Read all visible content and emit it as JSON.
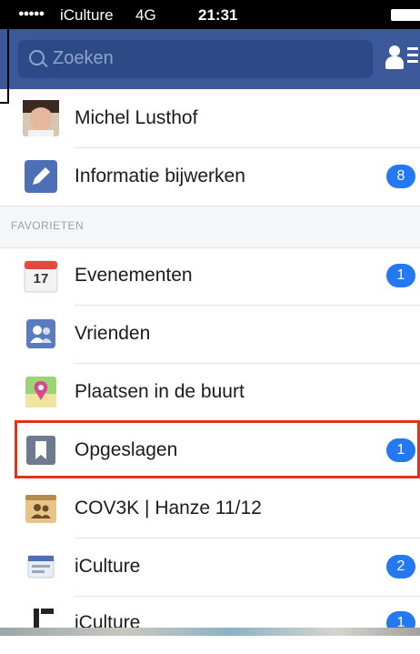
{
  "status_bar": {
    "signal": "●●●●●",
    "carrier": "iCulture",
    "network": "4G",
    "time": "21:31"
  },
  "search": {
    "placeholder": "Zoeken"
  },
  "profile": {
    "name": "Michel Lusthof"
  },
  "menu_top": [
    {
      "label": "Informatie bijwerken",
      "badge": "8",
      "icon": "pencil-icon"
    }
  ],
  "section": {
    "title": "FAVORIETEN"
  },
  "favorites": [
    {
      "label": "Evenementen",
      "badge": "1",
      "icon": "calendar-icon",
      "calendar_day": "17"
    },
    {
      "label": "Vrienden",
      "badge": "",
      "icon": "friends-icon"
    },
    {
      "label": "Plaatsen in de buurt",
      "badge": "",
      "icon": "map-pin-icon"
    },
    {
      "label": "Opgeslagen",
      "badge": "1",
      "icon": "bookmark-icon"
    },
    {
      "label": "COV3K | Hanze 11/12",
      "badge": "",
      "icon": "group-icon"
    },
    {
      "label": "iCulture",
      "badge": "2",
      "icon": "page-icon"
    },
    {
      "label": "iCulture",
      "badge": "1",
      "icon": "page-icon"
    }
  ],
  "colors": {
    "header": "#3b5998",
    "badge": "#2478f0",
    "highlight": "#e3341b"
  }
}
